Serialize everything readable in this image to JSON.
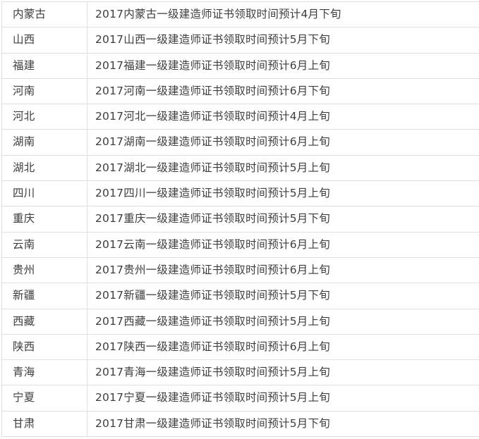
{
  "table": {
    "columns": [
      "region",
      "detail"
    ],
    "rows": [
      {
        "region": "内蒙古",
        "detail": "2017内蒙古一级建造师证书领取时间预计4月下旬"
      },
      {
        "region": "山西",
        "detail": "2017山西一级建造师证书领取时间预计5月下旬"
      },
      {
        "region": "福建",
        "detail": "2017福建一级建造师证书领取时间预计6月上旬"
      },
      {
        "region": "河南",
        "detail": "2017河南一级建造师证书领取时间预计6月下旬"
      },
      {
        "region": "河北",
        "detail": "2017河北一级建造师证书领取时间预计4月上旬"
      },
      {
        "region": "湖南",
        "detail": "2017湖南一级建造师证书领取时间预计6月上旬"
      },
      {
        "region": "湖北",
        "detail": "2017湖北一级建造师证书领取时间预计5月上旬"
      },
      {
        "region": "四川",
        "detail": "2017四川一级建造师证书领取时间预计5月上旬"
      },
      {
        "region": "重庆",
        "detail": "2017重庆一级建造师证书领取时间预计5月下旬"
      },
      {
        "region": "云南",
        "detail": "2017云南一级建造师证书领取时间预计6月上旬"
      },
      {
        "region": "贵州",
        "detail": "2017贵州一级建造师证书领取时间预计6月上旬"
      },
      {
        "region": "新疆",
        "detail": "2017新疆一级建造师证书领取时间预计5月下旬"
      },
      {
        "region": "西藏",
        "detail": "2017西藏一级建造师证书领取时间预计5月上旬"
      },
      {
        "region": "陕西",
        "detail": "2017陕西一级建造师证书领取时间预计6月上旬"
      },
      {
        "region": "青海",
        "detail": "2017青海一级建造师证书领取时间预计5月上旬"
      },
      {
        "region": "宁夏",
        "detail": "2017宁夏一级建造师证书领取时间预计5月上旬"
      },
      {
        "region": "甘肃",
        "detail": "2017甘肃一级建造师证书领取时间预计5月下旬"
      }
    ]
  },
  "colors": {
    "border": "#dfdfdf",
    "text": "#3d3d3d",
    "background": "#ffffff"
  }
}
